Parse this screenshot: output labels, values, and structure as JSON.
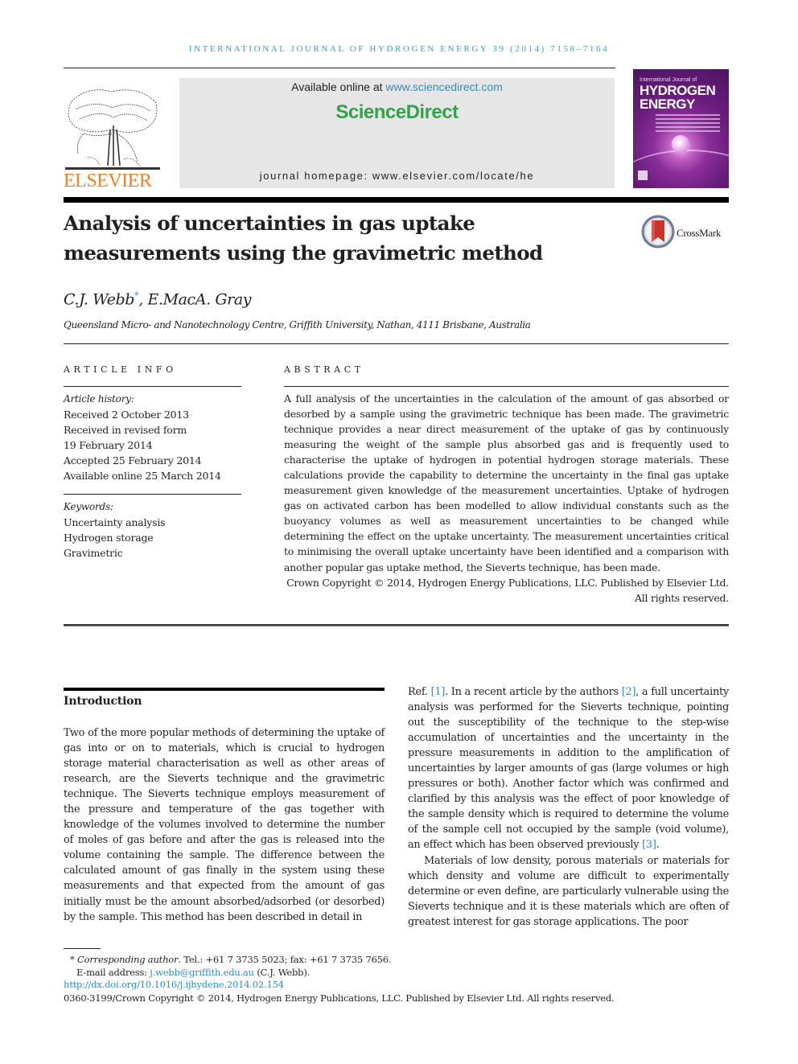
{
  "header": {
    "journal_line": "INTERNATIONAL JOURNAL OF HYDROGEN ENERGY 39 (2014) 7158–7164",
    "publisher_logo_text": "ELSEVIER",
    "available_online_prefix": "Available online at ",
    "available_online_link": "www.sciencedirect.com",
    "sciencedirect_logo": "ScienceDirect",
    "journal_homepage": "journal homepage: www.elsevier.com/locate/he",
    "cover": {
      "line1": "International Journal of",
      "line2": "HYDROGEN",
      "line3": "ENERGY"
    },
    "colors": {
      "journal_line": "#3a9ec4",
      "elsevier": "#f47f24",
      "sciencedirect": "#33a34b",
      "link": "#2d8fc4"
    }
  },
  "article": {
    "title_line1": "Analysis of uncertainties in gas uptake",
    "title_line2": "measurements using the gravimetric method",
    "crossmark_label": "CrossMark",
    "authors_1": "C.J. Webb",
    "authors_marker": "*",
    "authors_2": ", E.MacA. Gray",
    "affiliation": "Queensland Micro- and Nanotechnology Centre, Griffith University, Nathan, 4111 Brisbane, Australia"
  },
  "article_info": {
    "heading": "ARTICLE INFO",
    "history_label": "Article history:",
    "history": [
      "Received 2 October 2013",
      "Received in revised form",
      "19 February 2014",
      "Accepted 25 February 2014",
      "Available online 25 March 2014"
    ],
    "keywords_label": "Keywords:",
    "keywords": [
      "Uncertainty analysis",
      "Hydrogen storage",
      "Gravimetric"
    ]
  },
  "abstract": {
    "heading": "ABSTRACT",
    "text": "A full analysis of the uncertainties in the calculation of the amount of gas absorbed or desorbed by a sample using the gravimetric technique has been made. The gravimetric technique provides a near direct measurement of the uptake of gas by continuously measuring the weight of the sample plus absorbed gas and is frequently used to characterise the uptake of hydrogen in potential hydrogen storage materials. These calculations provide the capability to determine the uncertainty in the final gas uptake measurement given knowledge of the measurement uncertainties. Uptake of hydrogen gas on activated carbon has been modelled to allow individual constants such as the buoyancy volumes as well as measurement uncertainties to be changed while determining the effect on the uptake uncertainty. The measurement uncertainties critical to minimising the overall uptake uncertainty have been identified and a comparison with another popular gas uptake method, the Sieverts technique, has been made.",
    "copyright": "Crown Copyright © 2014, Hydrogen Energy Publications, LLC. Published by Elsevier Ltd. All rights reserved."
  },
  "introduction": {
    "heading": "Introduction",
    "left_para": "Two of the more popular methods of determining the uptake of gas into or on to materials, which is crucial to hydrogen storage material characterisation as well as other areas of research, are the Sieverts technique and the gravimetric technique. The Sieverts technique employs measurement of the pressure and temperature of the gas together with knowledge of the volumes involved to determine the number of moles of gas before and after the gas is released into the volume containing the sample. The difference between the calculated amount of gas finally in the system using these measurements and that expected from the amount of gas initially must be the amount absorbed/adsorbed (or desorbed) by the sample. This method has been described in detail in",
    "right_p1_a": "Ref. ",
    "ref1": "[1]",
    "right_p1_b": ". In a recent article by the authors ",
    "ref2": "[2]",
    "right_p1_c": ", a full uncertainty analysis was performed for the Sieverts technique, pointing out the susceptibility of the technique to the step-wise accumulation of uncertainties and the uncertainty in the pressure measurements in addition to the amplification of uncertainties by larger amounts of gas (large volumes or high pressures or both). Another factor which was confirmed and clarified by this analysis was the effect of poor knowledge of the sample density which is required to determine the volume of the sample cell not occupied by the sample (void volume), an effect which has been observed previously ",
    "ref3": "[3]",
    "right_p1_d": ".",
    "right_p2": "Materials of low density, porous materials or materials for which density and volume are difficult to experimentally determine or even define, are particularly vulnerable using the Sieverts technique and it is these materials which are often of greatest interest for gas storage applications. The poor"
  },
  "footnotes": {
    "marker": "*",
    "corr_label": "Corresponding author",
    "corr_text": ". Tel.: +61 7 3735 5023; fax: +61 7 3735 7656.",
    "email_label": "E-mail address: ",
    "email": "j.webb@griffith.edu.au",
    "email_suffix": " (C.J. Webb).",
    "doi": "http://dx.doi.org/10.1016/j.ijhydene.2014.02.154",
    "copyright": "0360-3199/Crown Copyright © 2014, Hydrogen Energy Publications, LLC. Published by Elsevier Ltd. All rights reserved."
  }
}
